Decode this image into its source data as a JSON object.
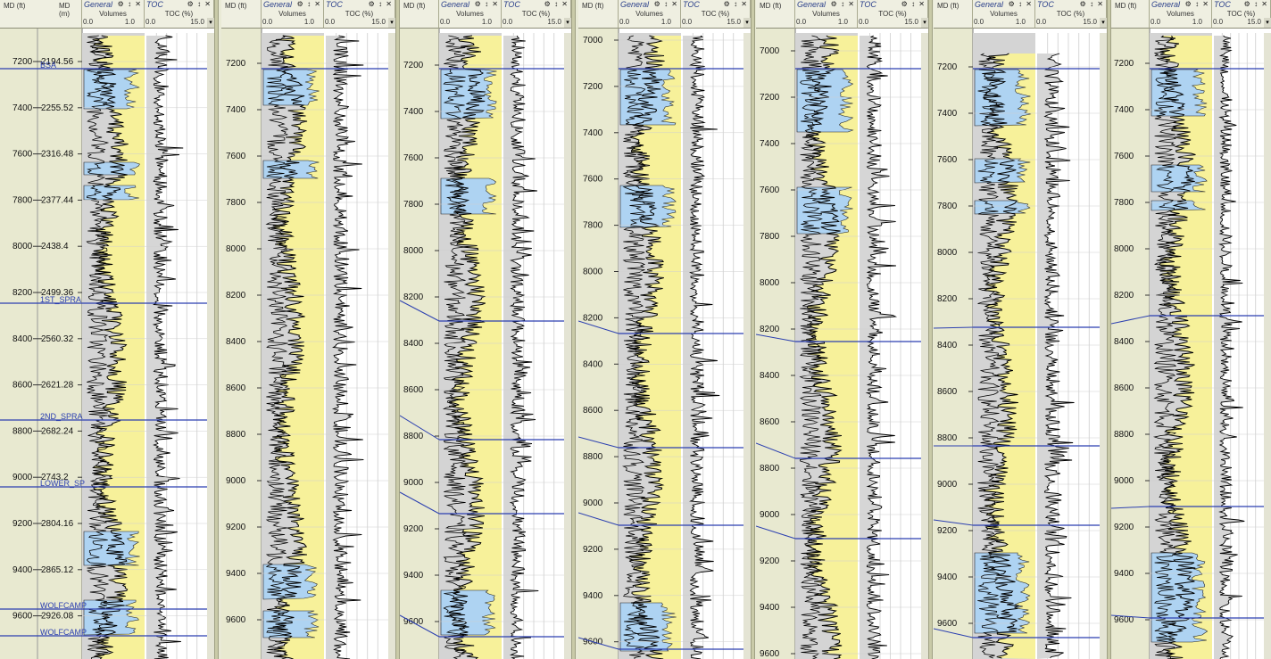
{
  "header": {
    "md_ft_label": "MD (ft)",
    "md_m_label": "MD (m)",
    "general_title": "General",
    "toc_title": "TOC",
    "volumes_label": "Volumes",
    "volumes_min": "0.0",
    "volumes_max": "1.0",
    "toc_label": "TOC (%)",
    "toc_min": "0.0",
    "toc_max": "15.0",
    "controls": "⚙ ↕ ✕"
  },
  "colors": {
    "sand": "#f7f19a",
    "porous": "#aed3f2",
    "shale": "#d4d4d4",
    "top_line": "#2b3fb0"
  },
  "tops": [
    "BSA",
    "1ST_SPRA",
    "2ND_SPRA",
    "LOWER_SP",
    "WOLFCAMP",
    "WOLFCAMP"
  ],
  "wells": [
    {
      "ft_ticks": [
        "7200",
        "7400",
        "7600",
        "7800",
        "8000",
        "8200",
        "8400",
        "8600",
        "8800",
        "9000",
        "9200",
        "9400",
        "9600"
      ],
      "m_ticks": [
        "2194.56",
        "2255.52",
        "2316.48",
        "2377.44",
        "2438.4",
        "2499.36",
        "2560.32",
        "2621.28",
        "2682.24",
        "2743.2",
        "2804.16",
        "2865.12",
        "2926.08"
      ]
    },
    {
      "ft_ticks": [
        "7200",
        "7400",
        "7600",
        "7800",
        "8000",
        "8200",
        "8400",
        "8600",
        "8800",
        "9000",
        "9200",
        "9400",
        "9600"
      ]
    },
    {
      "ft_ticks": [
        "7200",
        "7400",
        "7600",
        "7800",
        "8000",
        "8200",
        "8400",
        "8600",
        "8800",
        "9000",
        "9200",
        "9400",
        "9600"
      ]
    },
    {
      "ft_ticks": [
        "7000",
        "7200",
        "7400",
        "7600",
        "7800",
        "8000",
        "8200",
        "8400",
        "8600",
        "8800",
        "9000",
        "9200",
        "9400",
        "9600"
      ]
    },
    {
      "ft_ticks": [
        "7000",
        "7200",
        "7400",
        "7600",
        "7800",
        "8000",
        "8200",
        "8400",
        "8600",
        "8800",
        "9000",
        "9200",
        "9400",
        "9600"
      ]
    },
    {
      "ft_ticks": [
        "7200",
        "7400",
        "7600",
        "7800",
        "8000",
        "8200",
        "8400",
        "8600",
        "8800",
        "9000",
        "9200",
        "9400",
        "9600"
      ]
    },
    {
      "ft_ticks": [
        "7200",
        "7400",
        "7600",
        "7800",
        "8000",
        "8200",
        "8400",
        "8600",
        "8800",
        "9000",
        "9200",
        "9400",
        "9600"
      ]
    }
  ]
}
